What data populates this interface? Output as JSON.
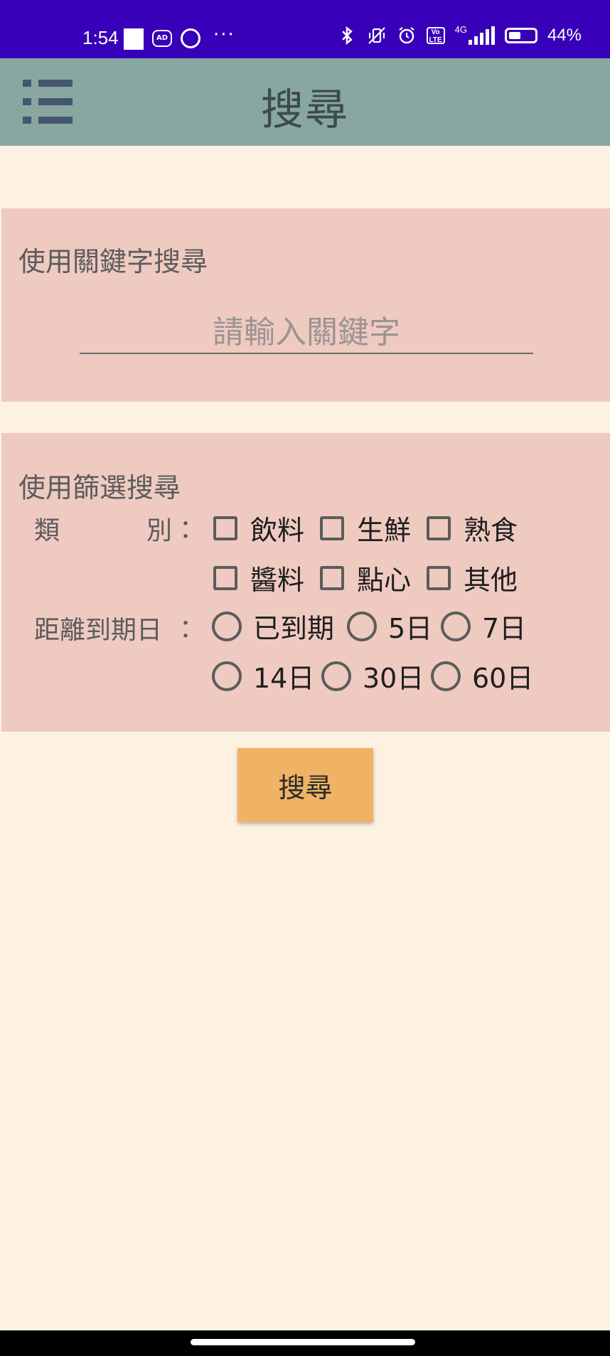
{
  "status_bar": {
    "time": "1:54",
    "ad_badge": "AD",
    "more": "···",
    "network": "4G",
    "volte": "Vo LTE",
    "battery": "44%"
  },
  "app_bar": {
    "title": "搜尋",
    "menu_icon": "list-menu-icon"
  },
  "keyword_section": {
    "heading": "使用關鍵字搜尋",
    "input_placeholder": "請輸入關鍵字",
    "input_value": ""
  },
  "filter_section": {
    "heading": "使用篩選搜尋",
    "category_label_a": "類",
    "category_label_b": "別",
    "colon": "：",
    "categories": [
      "飲料",
      "生鮮",
      "熟食",
      "醬料",
      "點心",
      "其他"
    ],
    "expiry_label": "距離到期日",
    "expiry_options": [
      "已到期",
      "5日",
      "7日",
      "14日",
      "30日",
      "60日"
    ]
  },
  "search_button": "搜尋",
  "colors": {
    "status_bar": "#3800b8",
    "app_bar": "#88a7a0",
    "background": "#fdf1e2",
    "card": "#efcac1",
    "button": "#f0b265"
  }
}
